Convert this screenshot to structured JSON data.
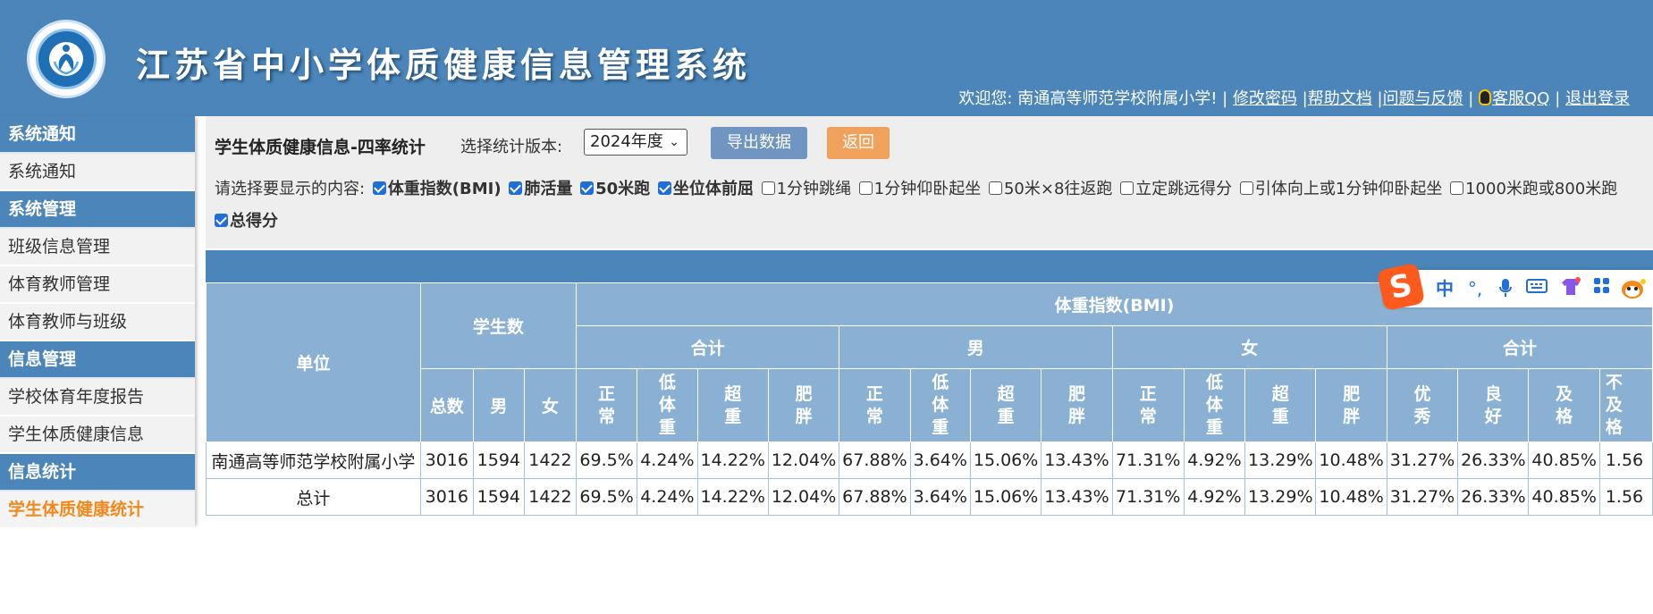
{
  "header": {
    "title": "江苏省中小学体质健康信息管理系统",
    "welcome": "欢迎您: 南通高等师范学校附属小学! |",
    "links": {
      "change_password": "修改密码",
      "help": "帮助文档",
      "feedback": "问题与反馈",
      "qq": "客服QQ",
      "logout": "退出登录"
    },
    "separators": [
      "|",
      "|",
      "|",
      "|"
    ]
  },
  "sidebar": {
    "sections": [
      {
        "title": "系统通知",
        "items": [
          "系统通知"
        ]
      },
      {
        "title": "系统管理",
        "items": [
          "班级信息管理",
          "体育教师管理",
          "体育教师与班级"
        ]
      },
      {
        "title": "信息管理",
        "items": [
          "学校体育年度报告",
          "学生体质健康信息"
        ]
      },
      {
        "title": "信息统计",
        "items": [
          "学生体质健康统计"
        ]
      }
    ]
  },
  "toolbar": {
    "page_title": "学生体质健康信息-四率统计",
    "version_label": "选择统计版本:",
    "version_selected": "2024年度",
    "export_label": "导出数据",
    "back_label": "返回"
  },
  "options": {
    "prompt": "请选择要显示的内容:",
    "items": [
      {
        "label": "体重指数(BMI)",
        "checked": true
      },
      {
        "label": "肺活量",
        "checked": true
      },
      {
        "label": "50米跑",
        "checked": true
      },
      {
        "label": "坐位体前屈",
        "checked": true
      },
      {
        "label": "1分钟跳绳",
        "checked": false
      },
      {
        "label": "1分钟仰卧起坐",
        "checked": false
      },
      {
        "label": "50米×8往返跑",
        "checked": false
      },
      {
        "label": "立定跳远得分",
        "checked": false
      },
      {
        "label": "引体向上或1分钟仰卧起坐",
        "checked": false
      },
      {
        "label": "1000米跑或800米跑",
        "checked": false
      },
      {
        "label": "总得分",
        "checked": true
      }
    ]
  },
  "table": {
    "h_unit": "单位",
    "h_students": "学生数",
    "h_bmi": "体重指数(BMI)",
    "h_total": "合计",
    "h_male": "男",
    "h_female": "女",
    "h_total2": "合计",
    "sub_students": [
      "总数",
      "男",
      "女"
    ],
    "sub_bmi": [
      "正常",
      "低体重",
      "超重",
      "肥胖"
    ],
    "sub_grade": [
      "优秀",
      "良好",
      "及格",
      "不及格"
    ],
    "rows": [
      {
        "unit": "南通高等师范学校附属小学",
        "cells": [
          "3016",
          "1594",
          "1422",
          "69.5%",
          "4.24%",
          "14.22%",
          "12.04%",
          "67.88%",
          "3.64%",
          "15.06%",
          "13.43%",
          "71.31%",
          "4.92%",
          "13.29%",
          "10.48%",
          "31.27%",
          "26.33%",
          "40.85%",
          "1.56"
        ]
      },
      {
        "unit": "总计",
        "cells": [
          "3016",
          "1594",
          "1422",
          "69.5%",
          "4.24%",
          "14.22%",
          "12.04%",
          "67.88%",
          "3.64%",
          "15.06%",
          "13.43%",
          "71.31%",
          "4.92%",
          "13.29%",
          "10.48%",
          "31.27%",
          "26.33%",
          "40.85%",
          "1.56"
        ]
      }
    ]
  },
  "ime": {
    "logo": "S",
    "mode": "中",
    "punct": "°,",
    "mic": "🎤",
    "keyboard": "⌨"
  },
  "colors": {
    "header_bg": "#4b85b9",
    "table_header": "#8ab0d3",
    "export_btn": "#6f95c0",
    "back_btn": "#f0a15c",
    "active_nav": "#f08a1c"
  }
}
